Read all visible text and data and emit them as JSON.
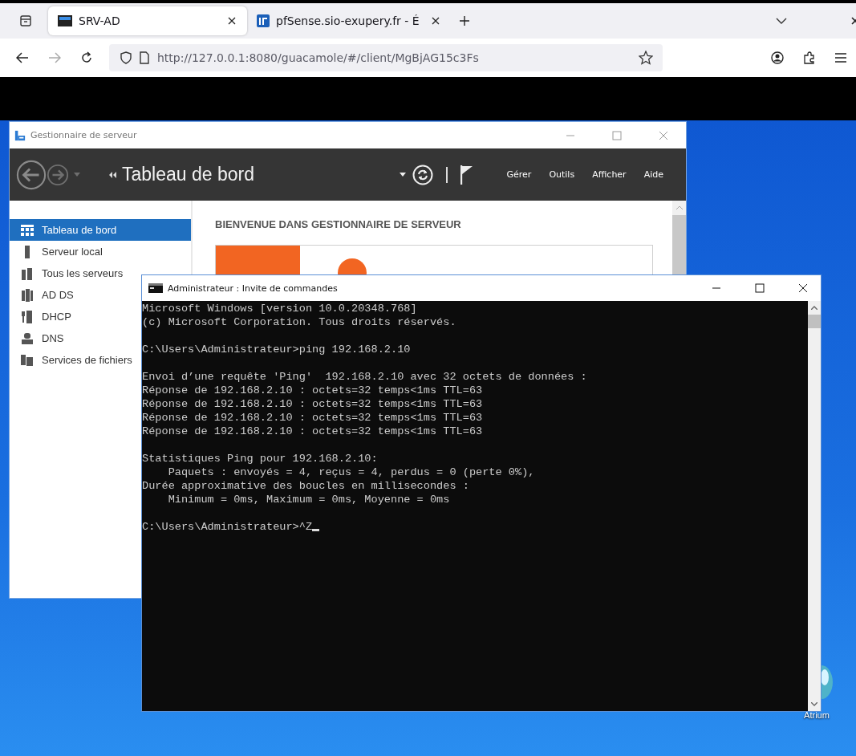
{
  "browser": {
    "tabs": [
      {
        "title": "SRV-AD",
        "selected": true
      },
      {
        "title": "pfSense.sio-exupery.fr - É",
        "selected": false
      }
    ],
    "address": "http://127.0.0.1:8080/guacamole/#/client/MgBjAG15c3Fs"
  },
  "server_manager": {
    "title": "Gestionnaire de serveur",
    "page_title": "Tableau de bord",
    "menu": [
      "Gérer",
      "Outils",
      "Afficher",
      "Aide"
    ],
    "sidebar": [
      {
        "label": "Tableau de bord",
        "selected": true
      },
      {
        "label": "Serveur local",
        "selected": false
      },
      {
        "label": "Tous les serveurs",
        "selected": false
      },
      {
        "label": "AD DS",
        "selected": false
      },
      {
        "label": "DHCP",
        "selected": false
      },
      {
        "label": "DNS",
        "selected": false
      },
      {
        "label": "Services de fichiers",
        "selected": false
      }
    ],
    "welcome_heading": "BIENVENUE DANS GESTIONNAIRE DE SERVEUR"
  },
  "console": {
    "title": "Administrateur : Invite de commandes",
    "blocks": [
      [
        "Microsoft Windows [version 10.0.20348.768]",
        "(c) Microsoft Corporation. Tous droits réservés."
      ],
      [
        "C:\\Users\\Administrateur>ping 192.168.2.10"
      ],
      [
        "Envoi d’une requête 'Ping'  192.168.2.10 avec 32 octets de données :",
        "Réponse de 192.168.2.10 : octets=32 temps<1ms TTL=63",
        "Réponse de 192.168.2.10 : octets=32 temps<1ms TTL=63",
        "Réponse de 192.168.2.10 : octets=32 temps<1ms TTL=63",
        "Réponse de 192.168.2.10 : octets=32 temps<1ms TTL=63"
      ],
      [
        "Statistiques Ping pour 192.168.2.10:",
        "    Paquets : envoyés = 4, reçus = 4, perdus = 0 (perte 0%),",
        "Durée approximative des boucles en millisecondes :",
        "    Minimum = 0ms, Maximum = 0ms, Moyenne = 0ms"
      ],
      [
        "C:\\Users\\Administrateur>^Z"
      ]
    ]
  },
  "desktop_icons": [
    {
      "label": "Atrium"
    }
  ]
}
